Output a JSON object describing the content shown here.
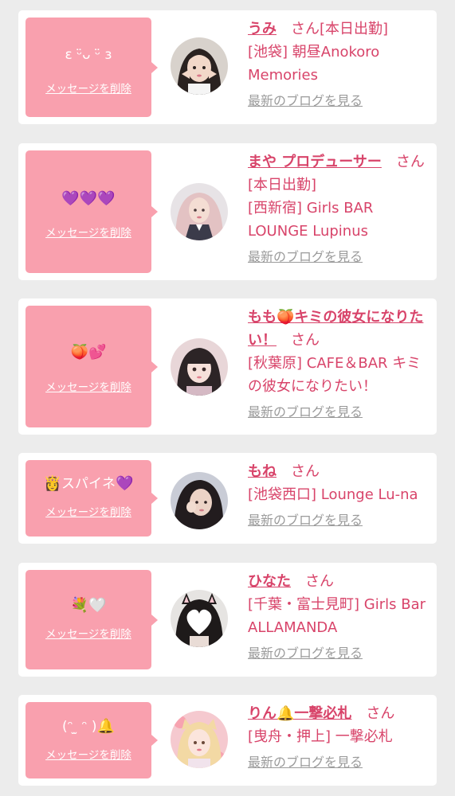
{
  "delete_label": "メッセージを削除",
  "blog_label": "最新のブログを見る",
  "san_label": "さん",
  "colors": {
    "card_background": "#ffffff",
    "page_background": "#ececec",
    "message_box": "#f9a0ae",
    "accent_text": "#d8446a",
    "blog_link": "#9b9b9b"
  },
  "cards": [
    {
      "message": "ε ᵕ̈ᴗ ᵕ̈ ɜ",
      "cast_name": "うみ",
      "status": "[本日出勤]",
      "shop": "[池袋] 朝昼Anokoro Memories",
      "avatar_icon": "avatar-photo"
    },
    {
      "message": "💜💜💜",
      "cast_name": "まや プロデューサー",
      "status": "[本日出勤]",
      "shop": "[西新宿] Girls BAR LOUNGE Lupinus",
      "avatar_icon": "avatar-photo"
    },
    {
      "message": "🍑💕",
      "cast_name_part1": "もも",
      "cast_name_emoji": "🍑",
      "cast_name_part2": "キミの彼女になりたい！",
      "status": "",
      "shop": "[秋葉原] CAFE＆BAR キミの彼女になりたい！",
      "avatar_icon": "avatar-photo"
    },
    {
      "message_emoji1": "👸",
      "message_text": "スパイネ",
      "message_emoji2": "💜",
      "cast_name": "もね",
      "status": "",
      "shop": "[池袋西口] Lounge Lu-na",
      "avatar_icon": "avatar-photo"
    },
    {
      "message": "💐🤍",
      "cast_name": "ひなた",
      "status": "",
      "shop": "[千葉・富士見町] Girls Bar ALLAMANDA",
      "avatar_icon": "avatar-photo"
    },
    {
      "message_text": "(ᵔ ̫ ᵔ )",
      "message_emoji": "🔔",
      "cast_name_part1": "りん",
      "cast_name_emoji": "🔔",
      "cast_name_part2": "一撃必札",
      "status": "",
      "shop": "[曳舟・押上] 一撃必札",
      "avatar_icon": "avatar-photo"
    }
  ]
}
